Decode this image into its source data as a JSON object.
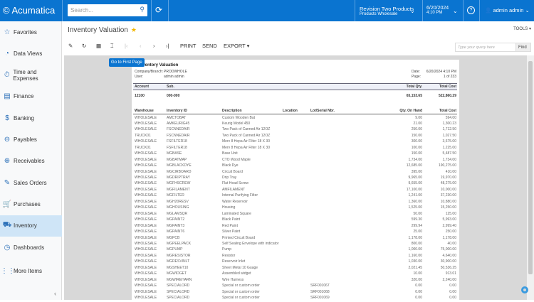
{
  "topbar": {
    "logo": "Acumatica",
    "search_placeholder": "Search...",
    "branch_title": "Revision Two Products",
    "branch_sub": "Products Wholesale",
    "date": "6/20/2024",
    "time": "4:10 PM",
    "user": "admin admin"
  },
  "sidebar": {
    "items": [
      {
        "label": "Favorites",
        "icon": "☆"
      },
      {
        "label": "Data Views",
        "icon": "◔"
      },
      {
        "label": "Time and Expenses",
        "icon": "⏱"
      },
      {
        "label": "Finance",
        "icon": "▤"
      },
      {
        "label": "Banking",
        "icon": "$"
      },
      {
        "label": "Payables",
        "icon": "⊖"
      },
      {
        "label": "Receivables",
        "icon": "⊕"
      },
      {
        "label": "Sales Orders",
        "icon": "✎"
      },
      {
        "label": "Purchases",
        "icon": "🛒"
      },
      {
        "label": "Inventory",
        "icon": "⛟"
      },
      {
        "label": "Dashboards",
        "icon": "◷"
      },
      {
        "label": "More Items",
        "icon": "⋮⋮"
      }
    ],
    "active": "Inventory"
  },
  "page": {
    "title": "Inventory Valuation",
    "tools": "TOOLS ▾"
  },
  "toolbar": {
    "print": "PRINT",
    "send": "SEND",
    "export": "EXPORT ▾",
    "query_placeholder": "Type your query here",
    "find": "Find",
    "tooltip": "Go to First Page"
  },
  "report": {
    "title": "Inventory Valuation",
    "company_label": "Company/Branch:",
    "company": "PRODWHOLE",
    "user_label": "User:",
    "user": "admin admin",
    "date_label": "Date:",
    "date": "6/20/2024 4:10 PM",
    "page_label": "Page:",
    "page": "1 of 233",
    "account_headers": [
      "Account",
      "Sub.",
      "Total Qty.",
      "Total Cost"
    ],
    "account_row": [
      "12100",
      "000-000",
      "65,153.65",
      "522,860.29"
    ],
    "columns": [
      "Warehouse",
      "Inventory ID",
      "Description",
      "Location",
      "Lot/Serial Nbr.",
      "Qty. On Hand",
      "Total Cost"
    ],
    "rows": [
      [
        "WHOLESALE",
        "AMCTOBAT",
        "Custom Wooden Bat",
        "",
        "",
        "9.00",
        "594.00"
      ],
      [
        "WHOLESALE",
        "AMKEURIG45",
        "Keurig Model 450",
        "",
        "",
        "21.00",
        "1,300.23"
      ],
      [
        "WHOLESALE",
        "FSCNNEDAIR",
        "Two Pack of Canned Air 12OZ",
        "",
        "",
        "250.00",
        "1,712.50"
      ],
      [
        "TRUCK01",
        "FSCNNEDAIR",
        "Two Pack of Canned Air 12OZ",
        "",
        "",
        "150.00",
        "1,027.50"
      ],
      [
        "WHOLESALE",
        "FSFILTER18",
        "Merv 8 Hepa Air Filter 18 X 30",
        "",
        "",
        "300.00",
        "3,675.00"
      ],
      [
        "TRUCK01",
        "FSFILTER18",
        "Merv 8 Hepa Air Filter 18 X 30",
        "",
        "",
        "100.00",
        "1,225.00"
      ],
      [
        "WHOLESALE",
        "MGBASE",
        "Base Unit",
        "",
        "",
        "150.00",
        "5,487.50"
      ],
      [
        "WHOLESALE",
        "MGBATMAP",
        "CTO Wood Maple",
        "",
        "",
        "1,734.00",
        "1,734.00"
      ],
      [
        "WHOLESALE",
        "MGBLACKDYE",
        "Black Dye",
        "",
        "",
        "12,685.00",
        "190,275.00"
      ],
      [
        "WHOLESALE",
        "MGCIRBOARD",
        "Circuit Board",
        "",
        "",
        "395.00",
        "410.00"
      ],
      [
        "WHOLESALE",
        "MGDRIPTRAY",
        "Drip Tray",
        "",
        "",
        "9,965.00",
        "19,970.00"
      ],
      [
        "WHOLESALE",
        "MGFHSCREW",
        "Flat Head Screw",
        "",
        "",
        "9,655.00",
        "48,275.00"
      ],
      [
        "WHOLESALE",
        "MGFILAMENT",
        "AMFILAMENT",
        "",
        "",
        "17,100.00",
        "10,000.00"
      ],
      [
        "WHOLESALE",
        "MGFILTER",
        "Internal Purifying Filter",
        "",
        "",
        "1,241.00",
        "37,230.00"
      ],
      [
        "WHOLESALE",
        "MGH20RESV",
        "Water Reservoir",
        "",
        "",
        "1,360.00",
        "10,880.00"
      ],
      [
        "WHOLESALE",
        "MGHOUSING",
        "Housing",
        "",
        "",
        "1,525.00",
        "15,250.00"
      ],
      [
        "WHOLESALE",
        "MGLAMSQR",
        "Laminated Square",
        "",
        "",
        "50.00",
        "125.00"
      ],
      [
        "WHOLESALE",
        "MGPAINT2",
        "Black Paint",
        "",
        "",
        "599.30",
        "5,993.00"
      ],
      [
        "WHOLESALE",
        "MGPAINT3",
        "Red Paint",
        "",
        "",
        "299.94",
        "2,999.40"
      ],
      [
        "WHOLESALE",
        "MGPAINT6",
        "Silver Paint",
        "",
        "",
        "25.00",
        "250.00"
      ],
      [
        "WHOLESALE",
        "MGPCB",
        "Printed Circuit Board",
        "",
        "",
        "1,178.00",
        "1,178.00"
      ],
      [
        "WHOLESALE",
        "MGPEELPACK",
        "Self Sealing Envelope with indicator",
        "",
        "",
        "800.00",
        "40.00"
      ],
      [
        "WHOLESALE",
        "MGPUMP",
        "Pump",
        "",
        "",
        "1,000.00",
        "75,000.00"
      ],
      [
        "WHOLESALE",
        "MGRESISTOR",
        "Resistor",
        "",
        "",
        "1,160.00",
        "4,640.00"
      ],
      [
        "WHOLESALE",
        "MGRESVINLT",
        "Reservoir Inlet",
        "",
        "",
        "1,030.00",
        "30,900.00"
      ],
      [
        "WHOLESALE",
        "MGSHEET10",
        "Sheet Metal 10 Guage",
        "",
        "",
        "2,021.45",
        "50,536.25"
      ],
      [
        "WHOLESALE",
        "MGWIDGET",
        "Assembled widget",
        "",
        "",
        "10.00",
        "913.01"
      ],
      [
        "WHOLESALE",
        "MGWIREHARN",
        "Wire Harness",
        "",
        "",
        "320.00",
        "2,240.00"
      ],
      [
        "WHOLESALE",
        "SPECIALORD",
        "Special or custom order",
        "",
        "SRF001067",
        "0.00",
        "0.00"
      ],
      [
        "WHOLESALE",
        "SPECIALORD",
        "Special or custom order",
        "",
        "SRF001068",
        "0.00",
        "0.00"
      ],
      [
        "WHOLESALE",
        "SPECIALORD",
        "Special or custom order",
        "",
        "SRF001069",
        "0.00",
        "0.00"
      ]
    ]
  },
  "colors": {
    "brand": "#0a74d0",
    "active_nav": "#cfe5f7",
    "star": "#f2b600"
  }
}
